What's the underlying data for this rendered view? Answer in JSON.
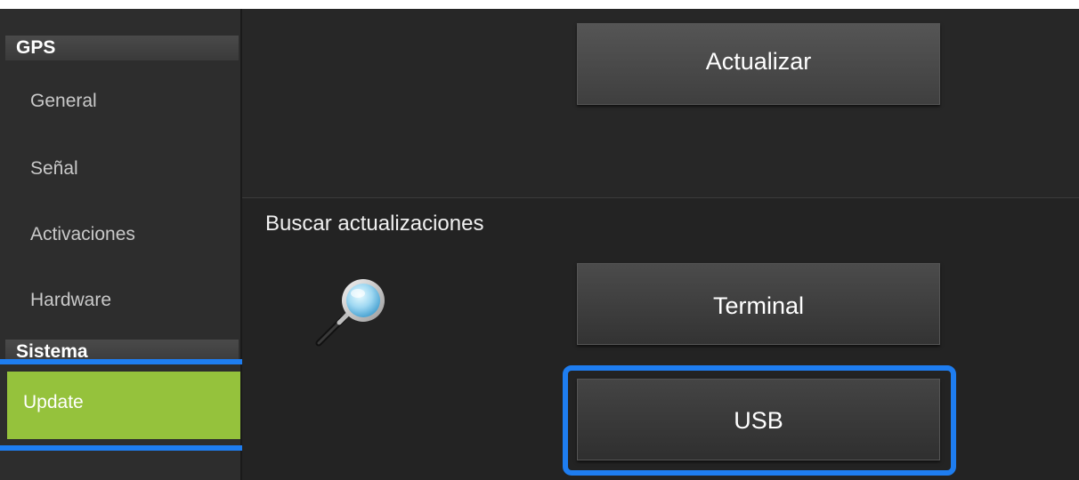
{
  "sidebar": {
    "sections": [
      {
        "header": "GPS",
        "items": [
          "General",
          "Señal",
          "Activaciones",
          "Hardware"
        ]
      },
      {
        "header": "Sistema",
        "items": [
          "Update"
        ]
      }
    ],
    "active_item": "Update"
  },
  "main": {
    "update_button": "Actualizar",
    "search_label": "Buscar actualizaciones",
    "terminal_button": "Terminal",
    "usb_button": "USB"
  },
  "colors": {
    "active_item": "#95c23c",
    "highlight": "#1e7df0",
    "background": "#2a2a2a"
  }
}
